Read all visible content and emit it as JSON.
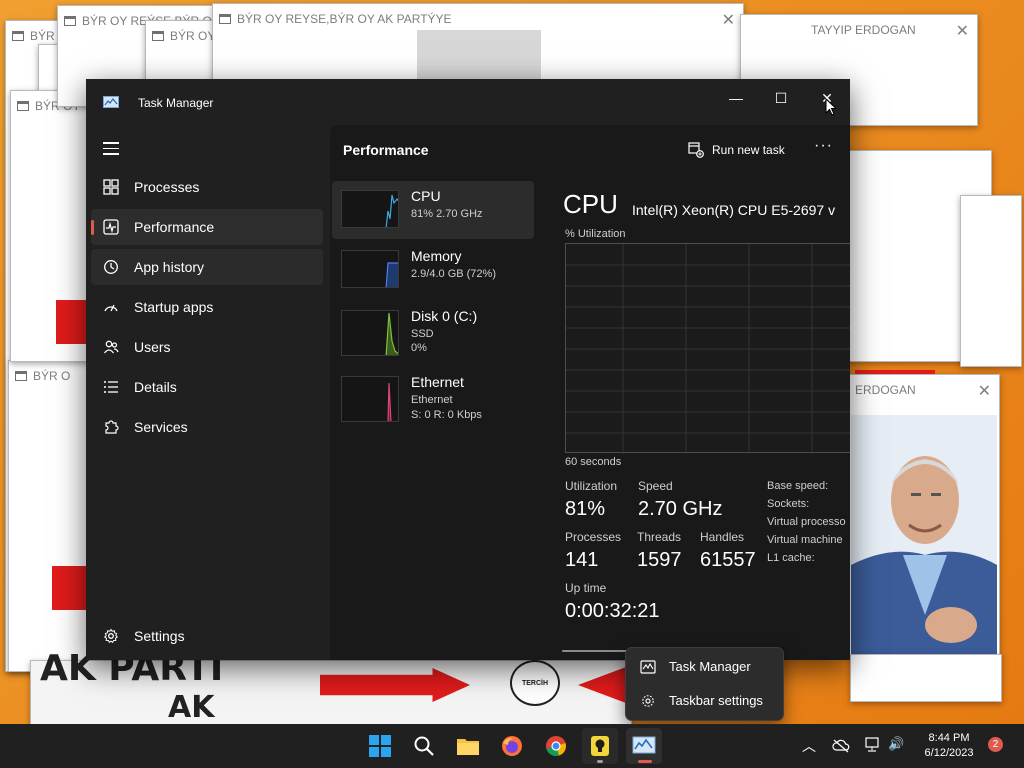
{
  "desktop_popups": [
    {
      "title": "BÝR OY REÝSE,BÝR OY AK",
      "close": "✕"
    },
    {
      "title": "BÝR OY REYSE,BÝR OY AK PARTÝYE",
      "close": "✕"
    },
    {
      "title": "BÝR",
      "close": "✕"
    },
    {
      "title": "BÝR OY",
      "close": "✕"
    },
    {
      "title": "BÝR O",
      "close": "✕"
    },
    {
      "title": "BÝR OY",
      "close": "✕"
    },
    {
      "title": "ERDOGAN",
      "close": "✕"
    },
    {
      "title": "TAYYIP ERDOGAN",
      "close": "✕"
    }
  ],
  "desktop_banner": {
    "text1": "AK PARTİ",
    "text2": "AK",
    "badge": "TERCİH"
  },
  "task_manager": {
    "title": "Task Manager",
    "window_controls": {
      "minimize": "—",
      "maximize": "☐",
      "close": "✕"
    },
    "nav": [
      {
        "label": "Processes",
        "icon": "processes-grid-icon"
      },
      {
        "label": "Performance",
        "icon": "performance-graph-icon"
      },
      {
        "label": "App history",
        "icon": "app-history-icon"
      },
      {
        "label": "Startup apps",
        "icon": "startup-speedometer-icon"
      },
      {
        "label": "Users",
        "icon": "users-icon"
      },
      {
        "label": "Details",
        "icon": "details-list-icon"
      },
      {
        "label": "Services",
        "icon": "services-puzzle-icon"
      }
    ],
    "settings_label": "Settings",
    "header": {
      "title": "Performance",
      "run_new_task": "Run new task",
      "more": "···"
    },
    "resources": [
      {
        "name": "CPU",
        "line1": "81% 2.70 GHz",
        "line2": "",
        "color": "#3fa9e0"
      },
      {
        "name": "Memory",
        "line1": "2.9/4.0 GB (72%)",
        "line2": "",
        "color": "#4d7ff0"
      },
      {
        "name": "Disk 0 (C:)",
        "line1": "SSD",
        "line2": "0%",
        "color": "#7cc23f"
      },
      {
        "name": "Ethernet",
        "line1": "Ethernet",
        "line2": "S: 0 R: 0 Kbps",
        "color": "#e1457f"
      }
    ],
    "cpu_detail": {
      "heading": "CPU",
      "model": "Intel(R) Xeon(R) CPU E5-2697 v",
      "util_label": "% Utilization",
      "time_label": "60 seconds",
      "stats": {
        "utilization_label": "Utilization",
        "utilization": "81%",
        "speed_label": "Speed",
        "speed": "2.70 GHz",
        "processes_label": "Processes",
        "processes": "141",
        "threads_label": "Threads",
        "threads": "1597",
        "handles_label": "Handles",
        "handles": "61557",
        "uptime_label": "Up time",
        "uptime": "0:00:32:21"
      },
      "specs": [
        "Base speed:",
        "Sockets:",
        "Virtual processo",
        "Virtual machine",
        "L1 cache:"
      ]
    }
  },
  "context_menu": [
    {
      "label": "Task Manager",
      "icon": "task-manager-icon"
    },
    {
      "label": "Taskbar settings",
      "icon": "gear-icon"
    }
  ],
  "taskbar": {
    "apps": [
      "start",
      "search",
      "file-explorer",
      "firefox",
      "chrome",
      "lightbulb-app",
      "task-manager"
    ],
    "tray": {
      "chevron": "︿",
      "network": "network-icon",
      "speaker": "🔊"
    },
    "time": "8:44 PM",
    "date": "6/12/2023",
    "notifications": "2"
  },
  "colors": {
    "accent": "#e05a4e",
    "cpu_line": "#3fa9e0",
    "dark_bg": "#202020",
    "desktop": "#e98a1e"
  }
}
